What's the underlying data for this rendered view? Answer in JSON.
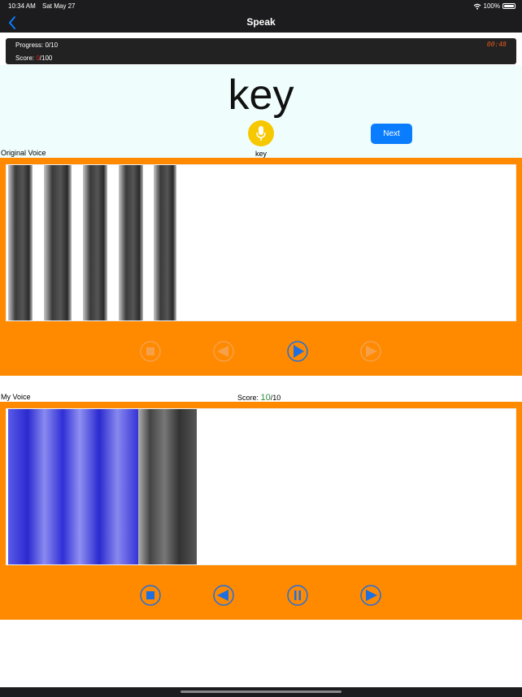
{
  "status": {
    "time": "10:34 AM",
    "date": "Sat May 27",
    "battery": "100%"
  },
  "nav": {
    "title": "Speak",
    "back_icon": "chevron-left-icon"
  },
  "info": {
    "progress": "Progress: 0/10",
    "score_prefix": "Score: ",
    "score_value": "0",
    "score_suffix": "/100",
    "timer": "00:48"
  },
  "word": {
    "main": "key",
    "small": "key",
    "next_label": "Next"
  },
  "original": {
    "label": "Original Voice"
  },
  "mine": {
    "label": "My Voice",
    "score_prefix": "Score: ",
    "score_value": "10",
    "score_suffix": "/10"
  },
  "colors": {
    "accent": "#ff8a00",
    "button_blue": "#0a7dff",
    "mic_yellow": "#f6c800",
    "score_green": "#2e8b3a",
    "score_red": "#e02020"
  }
}
